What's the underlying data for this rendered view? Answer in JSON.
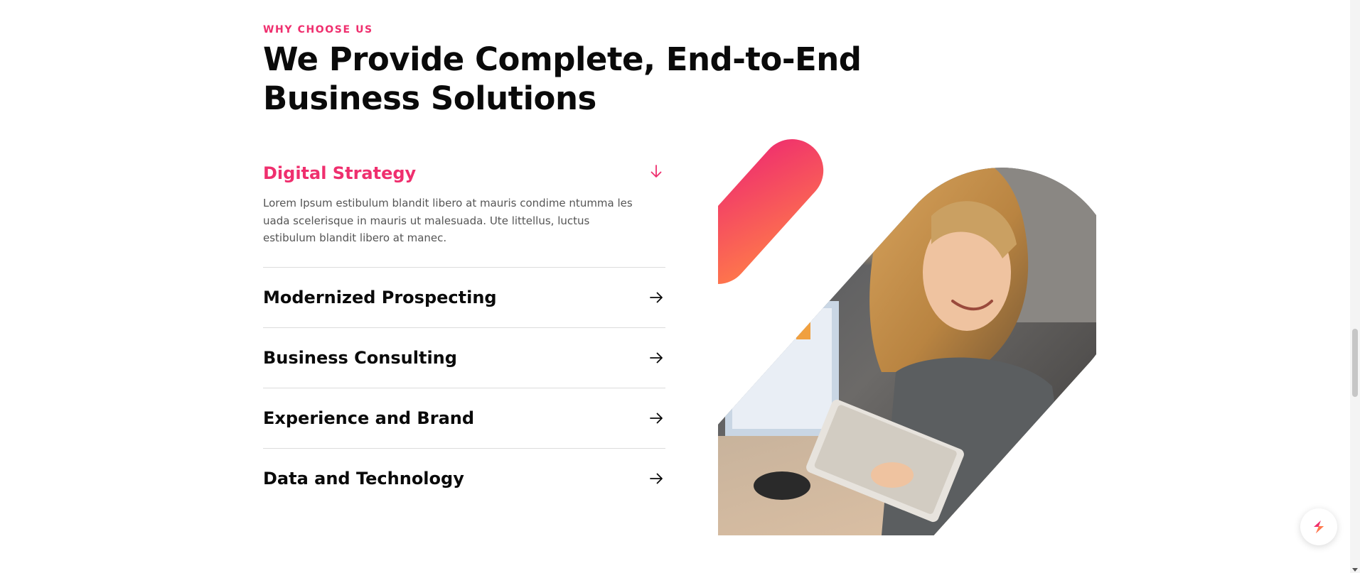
{
  "section": {
    "eyebrow": "WHY CHOOSE US",
    "headline": "We Provide Complete, End-to-End Business Solutions"
  },
  "accordion": {
    "items": [
      {
        "title": "Digital Strategy",
        "body": "Lorem Ipsum estibulum blandit libero at mauris condime ntumma les uada scelerisque in mauris ut malesuada. Ute littellus, luctus estibulum blandit libero at manec.",
        "state": "expanded",
        "icon": "arrow-down-icon"
      },
      {
        "title": "Modernized Prospecting",
        "state": "collapsed",
        "icon": "arrow-right-icon"
      },
      {
        "title": "Business Consulting",
        "state": "collapsed",
        "icon": "arrow-right-icon"
      },
      {
        "title": "Experience and Brand",
        "state": "collapsed",
        "icon": "arrow-right-icon"
      },
      {
        "title": "Data and Technology",
        "state": "collapsed",
        "icon": "arrow-right-icon"
      }
    ]
  },
  "illustration": {
    "subject": "woman smiling while holding a tablet in an office",
    "accent_gradient": [
      "#ef2f6e",
      "#ff7a4a"
    ]
  },
  "chat_widget": {
    "icon": "chat-logo-icon"
  },
  "colors": {
    "accent": "#ef2f6e",
    "heading": "#0a0a0a",
    "body_text": "#555555",
    "divider": "#dcdcdc"
  }
}
